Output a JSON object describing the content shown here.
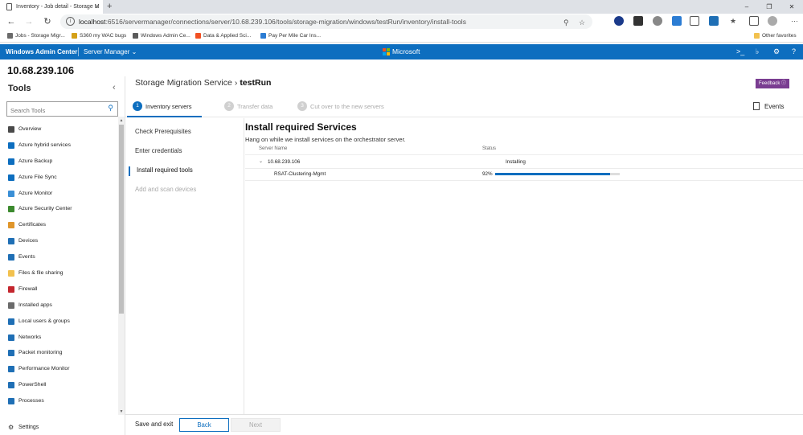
{
  "browser": {
    "tab_title": "Inventory - Job detail - Storage M",
    "tab_close": "×",
    "new_tab": "+",
    "window_controls": [
      "–",
      "❐",
      "✕"
    ],
    "url_host": "localhost",
    "url_rest": ":6516/servermanager/connections/server/10.68.239.106/tools/storage-migration/windows/testRun/inventory/install-tools",
    "bookmarks": [
      {
        "label": "Jobs - Storage Migr...",
        "color": "#6b6b6b"
      },
      {
        "label": "S360 my WAC bugs",
        "color": "#d4a017"
      },
      {
        "label": "Windows Admin Ce...",
        "color": "#5b5b5b"
      },
      {
        "label": "Data & Applied Sci...",
        "color": "#f25022"
      },
      {
        "label": "Pay Per Mile Car Ins...",
        "color": "#2b7cd3"
      }
    ],
    "other_favorites": "Other favorites"
  },
  "header": {
    "brand": "Windows Admin Center",
    "product_menu": "Server Manager",
    "microsoft": "Microsoft",
    "accent": "#0d6ebf"
  },
  "server_name": "10.68.239.106",
  "tools": {
    "title": "Tools",
    "search_placeholder": "Search Tools",
    "items": [
      {
        "label": "Overview",
        "icon": "overview-icon",
        "color": "#4a4a4a"
      },
      {
        "label": "Azure hybrid services",
        "icon": "azure-hybrid-icon",
        "color": "#0d6ebf"
      },
      {
        "label": "Azure Backup",
        "icon": "azure-backup-icon",
        "color": "#0d6ebf"
      },
      {
        "label": "Azure File Sync",
        "icon": "azure-file-sync-icon",
        "color": "#0d6ebf"
      },
      {
        "label": "Azure Monitor",
        "icon": "azure-monitor-icon",
        "color": "#3a8fd6"
      },
      {
        "label": "Azure Security Center",
        "icon": "azure-security-icon",
        "color": "#3c8a2e"
      },
      {
        "label": "Certificates",
        "icon": "certificate-icon",
        "color": "#e0962b"
      },
      {
        "label": "Devices",
        "icon": "devices-icon",
        "color": "#1f6fb5"
      },
      {
        "label": "Events",
        "icon": "events-icon",
        "color": "#1f6fb5"
      },
      {
        "label": "Files & file sharing",
        "icon": "folder-icon",
        "color": "#f2c14e"
      },
      {
        "label": "Firewall",
        "icon": "firewall-icon",
        "color": "#c4262e"
      },
      {
        "label": "Installed apps",
        "icon": "apps-icon",
        "color": "#6b6b6b"
      },
      {
        "label": "Local users & groups",
        "icon": "users-icon",
        "color": "#1f6fb5"
      },
      {
        "label": "Networks",
        "icon": "network-icon",
        "color": "#1f6fb5"
      },
      {
        "label": "Packet monitoring",
        "icon": "packet-icon",
        "color": "#1f6fb5"
      },
      {
        "label": "Performance Monitor",
        "icon": "performance-icon",
        "color": "#1f6fb5"
      },
      {
        "label": "PowerShell",
        "icon": "powershell-icon",
        "color": "#1f6fb5"
      },
      {
        "label": "Processes",
        "icon": "processes-icon",
        "color": "#1f6fb5"
      }
    ],
    "settings": "Settings"
  },
  "main": {
    "breadcrumb_parent": "Storage Migration Service",
    "breadcrumb_current": "testRun",
    "feedback": "Feedback",
    "steps": [
      {
        "number": "1",
        "label": "Inventory servers",
        "state": "active"
      },
      {
        "number": "2",
        "label": "Transfer data",
        "state": "inactive"
      },
      {
        "number": "3",
        "label": "Cut over to the new servers",
        "state": "inactive"
      }
    ],
    "events_label": "Events",
    "substeps": [
      {
        "label": "Check Prerequisites",
        "state": "done"
      },
      {
        "label": "Enter credentials",
        "state": "done"
      },
      {
        "label": "Install required tools",
        "state": "current"
      },
      {
        "label": "Add and scan devices",
        "state": "future"
      }
    ],
    "heading": "Install required Services",
    "description": "Hang on while we install services on the orchestrator server.",
    "columns": [
      "Server Name",
      "Status"
    ],
    "server_row": {
      "name": "10.68.239.106",
      "status": "Installing"
    },
    "feature_row": {
      "name": "RSAT-Clustering-Mgmt",
      "progress_label": "92%",
      "progress": 0.92
    }
  },
  "footer": {
    "save_exit": "Save and exit",
    "back": "Back",
    "next": "Next"
  }
}
